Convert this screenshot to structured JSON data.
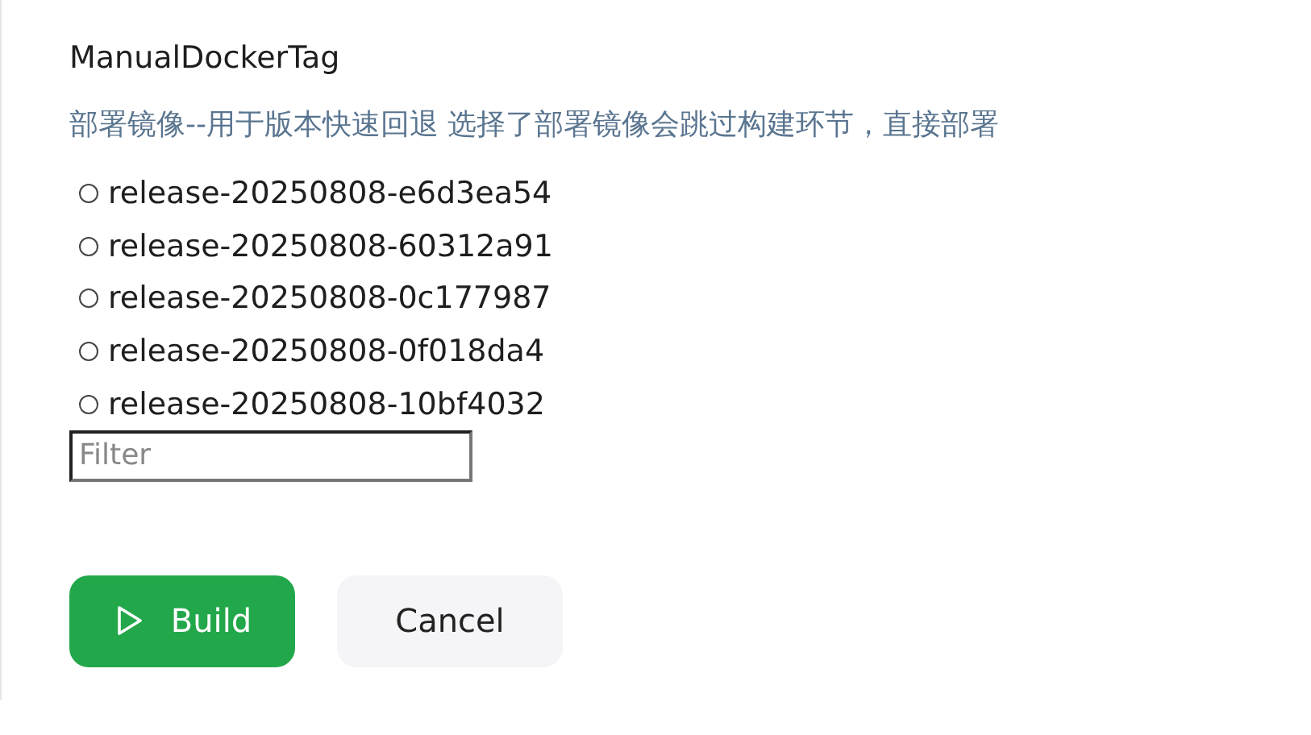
{
  "parameter": {
    "name": "ManualDockerTag",
    "description": "部署镜像--用于版本快速回退 选择了部署镜像会跳过构建环节，直接部署"
  },
  "options": [
    {
      "label": "release-20250808-e6d3ea54",
      "selected": false
    },
    {
      "label": "release-20250808-60312a91",
      "selected": false
    },
    {
      "label": "release-20250808-0c177987",
      "selected": false
    },
    {
      "label": "release-20250808-0f018da4",
      "selected": false
    },
    {
      "label": "release-20250808-10bf4032",
      "selected": false
    }
  ],
  "filter": {
    "placeholder": "Filter"
  },
  "buttons": [
    {
      "label": "Build",
      "kind": "primary"
    },
    {
      "label": "Cancel",
      "kind": "secondary"
    }
  ]
}
